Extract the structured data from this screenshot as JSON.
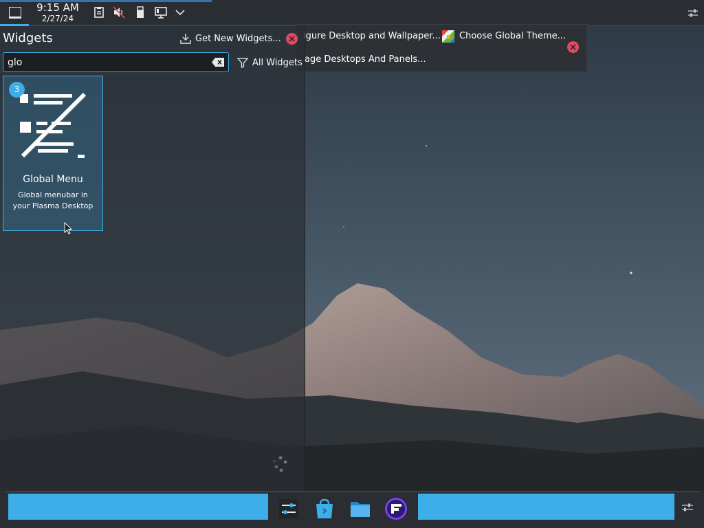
{
  "top_panel": {
    "clock": {
      "time": "9:15 AM",
      "date": "2/27/24"
    },
    "icons": [
      "show-desktop-icon",
      "clipboard-icon",
      "volume-muted-icon",
      "usb-device-icon",
      "network-wired-icon",
      "chevron-down-icon",
      "panel-settings-icon"
    ]
  },
  "toolbox": {
    "items": [
      {
        "label": "igure Desktop and Wallpaper...",
        "icon": "desktop-settings-icon"
      },
      {
        "label": "Choose Global Theme...",
        "icon": "global-theme-icon"
      },
      {
        "label": "age Desktops And Panels...",
        "icon": "desktop-panels-icon"
      }
    ],
    "close_color": "#e04b5e"
  },
  "widgets_panel": {
    "title": "Widgets",
    "get_new_label": "Get New Widgets...",
    "search": {
      "value": "glo",
      "placeholder": ""
    },
    "filter_label": "All Widgets",
    "widgets": [
      {
        "badge": "3",
        "name": "Global Menu",
        "description": "Global menubar in your Plasma Desktop",
        "icon": "global-menu-icon"
      }
    ]
  },
  "bottom_panel": {
    "tasks": [
      "system-settings-icon",
      "discover-store-icon",
      "file-manager-icon",
      "app-launcher-icon"
    ]
  },
  "colors": {
    "accent": "#3daee9",
    "panel": "#2a2e32",
    "close": "#e04b5e"
  }
}
